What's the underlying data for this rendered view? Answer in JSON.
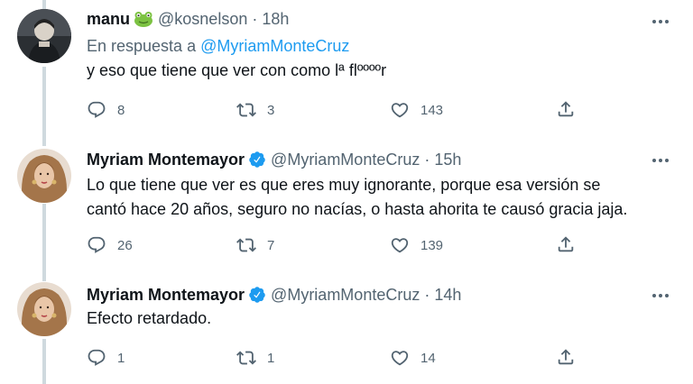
{
  "tweets": [
    {
      "name": "manu",
      "emoji": "frog-emoji",
      "handle": "@kosnelson",
      "separator": "·",
      "time": "18h",
      "reply_prefix": "En respuesta a ",
      "reply_mention": "@MyriamMonteCruz",
      "text": [
        "y eso que tiene que ver con como lª flººººr"
      ],
      "replies": "8",
      "retweets": "3",
      "likes": "143"
    },
    {
      "name": "Myriam Montemayor",
      "verified": true,
      "handle": "@MyriamMonteCruz",
      "separator": "·",
      "time": "15h",
      "text": [
        "Lo que tiene que ver es que eres muy ignorante, porque esa versión se",
        "cantó hace 20 años, seguro no nacías, o hasta ahorita te causó gracia jaja."
      ],
      "replies": "26",
      "retweets": "7",
      "likes": "139"
    },
    {
      "name": "Myriam Montemayor",
      "verified": true,
      "handle": "@MyriamMonteCruz",
      "separator": "·",
      "time": "14h",
      "text": [
        "Efecto retardado."
      ],
      "replies": "1",
      "retweets": "1",
      "likes": "14"
    }
  ],
  "icons": {
    "reply": "reply-icon",
    "retweet": "retweet-icon",
    "like": "heart-icon",
    "share": "share-icon",
    "more": "more-icon",
    "verified": "verified-badge-icon"
  },
  "colors": {
    "accent": "#1d9bf0",
    "secondary_text": "#536471",
    "thread_line": "#cfd9de",
    "frog_green": "#7cc242"
  }
}
